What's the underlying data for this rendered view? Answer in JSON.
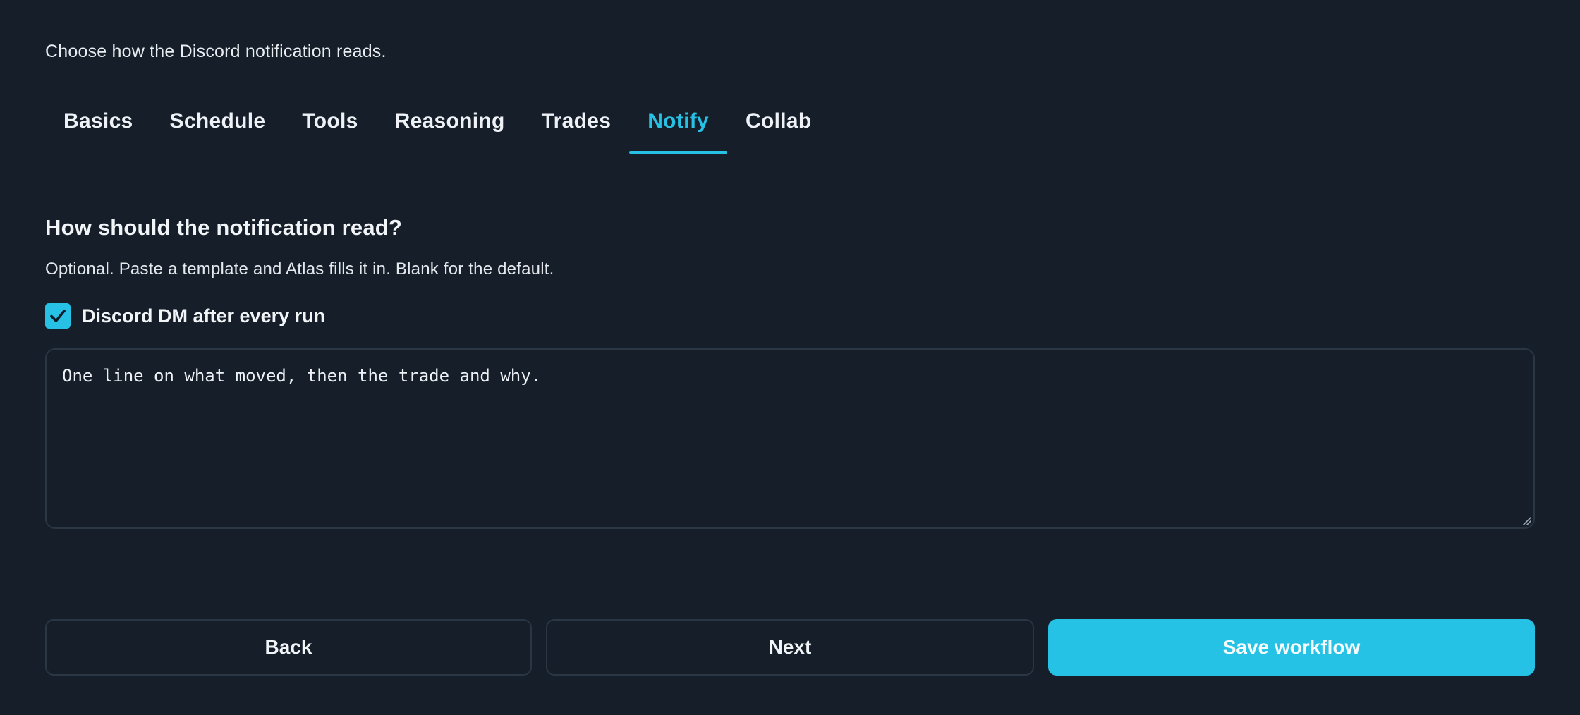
{
  "header": {
    "subtitle": "Choose how the Discord notification reads."
  },
  "tabs": [
    {
      "label": "Basics",
      "active": false
    },
    {
      "label": "Schedule",
      "active": false
    },
    {
      "label": "Tools",
      "active": false
    },
    {
      "label": "Reasoning",
      "active": false
    },
    {
      "label": "Trades",
      "active": false
    },
    {
      "label": "Notify",
      "active": true
    },
    {
      "label": "Collab",
      "active": false
    }
  ],
  "section": {
    "title": "How should the notification read?",
    "help": "Optional. Paste a template and Atlas fills it in. Blank for the default."
  },
  "discord_dm": {
    "label": "Discord DM after every run",
    "checked": true
  },
  "template": {
    "value": "One line on what moved, then the trade and why."
  },
  "footer": {
    "back_label": "Back",
    "next_label": "Next",
    "save_label": "Save workflow"
  },
  "colors": {
    "background": "#161f29",
    "accent": "#27c1e6",
    "border": "#2a3643",
    "text": "#eef2f6"
  },
  "icons": {
    "checkbox": "check-icon",
    "resize": "resize-grip-icon"
  }
}
